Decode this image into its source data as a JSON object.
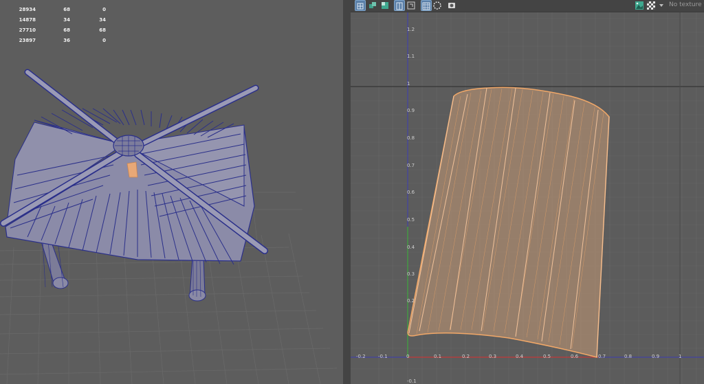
{
  "stats_table": {
    "rows": [
      {
        "c1": "",
        "c2": "",
        "c3": ""
      },
      {
        "c1": "28934",
        "c2": "68",
        "c3": "0"
      },
      {
        "c1": "14878",
        "c2": "34",
        "c3": "34"
      },
      {
        "c1": "27710",
        "c2": "68",
        "c3": "68"
      },
      {
        "c1": "23897",
        "c2": "36",
        "c3": "0"
      }
    ]
  },
  "uv_editor": {
    "texture_dropdown": "No texture fo",
    "toolbar_icons": [
      "uv-grid-icon",
      "uv-shell-icon",
      "uv-checker-tile-icon",
      "uv-distortion-icon",
      "uv-texture-border-icon",
      "uv-grid-snap-icon",
      "uv-shaded-icon",
      "uv-camera-icon",
      "image-display-icon",
      "checker-pattern-icon",
      "dropdown-arrow-icon"
    ],
    "axis_ticks_x": [
      "-0.2",
      "-0.1",
      "0",
      "0.1",
      "0.2",
      "0.3",
      "0.4",
      "0.5",
      "0.6",
      "0.7",
      "0.8",
      "0.9",
      "1"
    ],
    "axis_ticks_y": [
      "1.2",
      "1.1",
      "1",
      "0.9",
      "0.8",
      "0.7",
      "0.6",
      "0.5",
      "0.4",
      "0.3",
      "0.2",
      "-0.1"
    ]
  },
  "colors": {
    "viewport_bg": "#5d5d5d",
    "wireframe_blue": "#2a2f8a",
    "uv_orange": "#f2a868",
    "axis_red": "#c23a3a",
    "axis_green": "#3fa83f",
    "axis_blue": "#3b3bb5"
  }
}
